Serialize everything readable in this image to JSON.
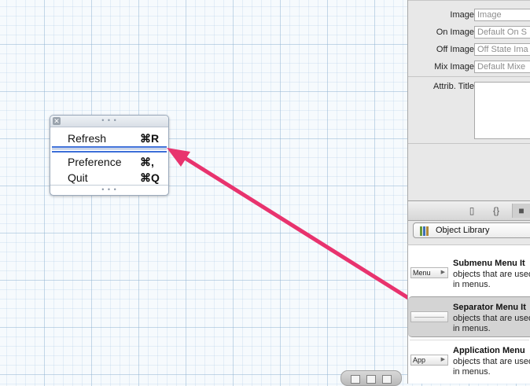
{
  "menu": {
    "close_glyph": "✕",
    "grip_glyph": "• • •",
    "items": [
      {
        "label": "Refresh",
        "shortcut": "⌘R"
      },
      {
        "label": "Preference",
        "shortcut": "⌘,"
      },
      {
        "label": "Quit",
        "shortcut": "⌘Q"
      }
    ]
  },
  "inspector": {
    "fields": [
      {
        "label": "Image",
        "placeholder": "Image"
      },
      {
        "label": "On Image",
        "placeholder": "Default On S"
      },
      {
        "label": "Off Image",
        "placeholder": "Off State Ima"
      },
      {
        "label": "Mix Image",
        "placeholder": "Default Mixe"
      }
    ],
    "attrib_title_label": "Attrib. Title"
  },
  "library": {
    "tabs": [
      {
        "name": "file-template-icon",
        "glyph": "▯"
      },
      {
        "name": "code-snippet-icon",
        "glyph": "{}"
      },
      {
        "name": "object-library-icon",
        "glyph": "■"
      }
    ],
    "selector_label": "Object Library",
    "items": [
      {
        "thumb": "Menu",
        "title": "Submenu Menu It",
        "desc1": "objects that are used",
        "desc2": "in menus."
      },
      {
        "thumb": "",
        "title": "Separator Menu It",
        "desc1": "objects that are used",
        "desc2": "in menus."
      },
      {
        "thumb": "App",
        "title": "Application Menu",
        "desc1": "objects that are used",
        "desc2": "in menus."
      }
    ]
  },
  "colors": {
    "arrow": "#e8336e",
    "selection": "#3d6fd8"
  }
}
